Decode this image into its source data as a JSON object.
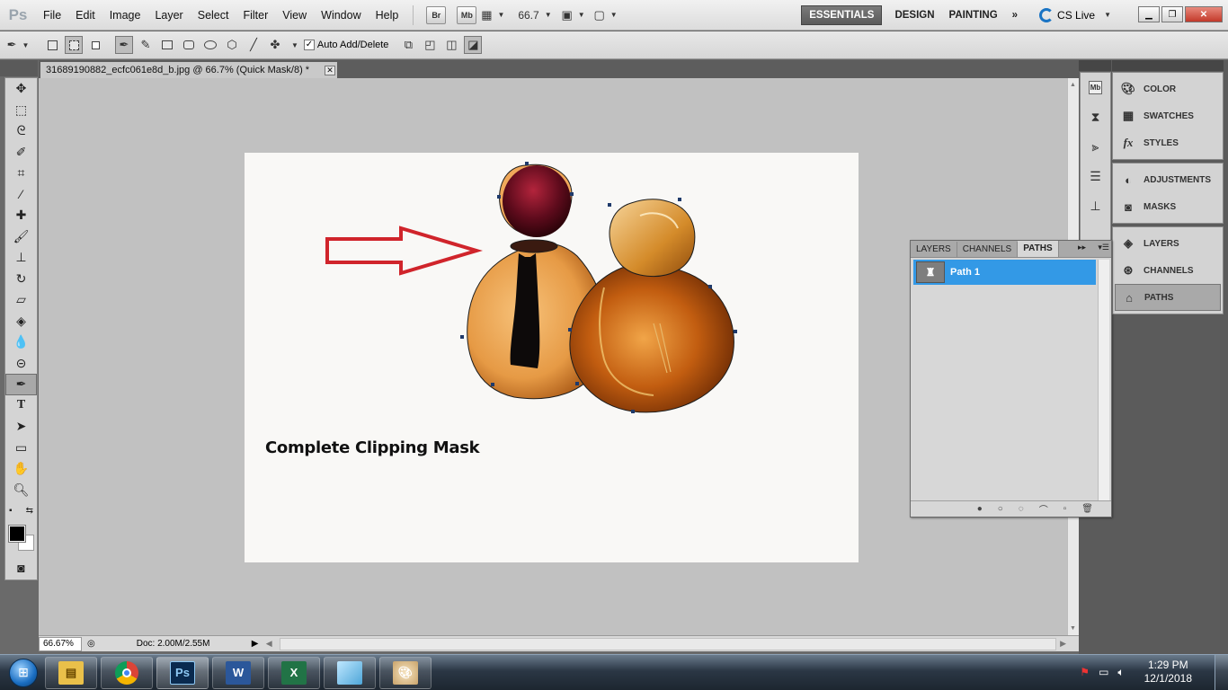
{
  "app": {
    "logo": "Ps",
    "menu": [
      "File",
      "Edit",
      "Image",
      "Layer",
      "Select",
      "Filter",
      "View",
      "Window",
      "Help"
    ],
    "bridge_label": "Br",
    "minibridge_label": "Mb",
    "zoom_value": "66.7",
    "workspaces": [
      "ESSENTIALS",
      "DESIGN",
      "PAINTING"
    ],
    "workspace_more": "»",
    "cslive_label": "CS Live"
  },
  "options_bar": {
    "auto_add_delete_label": "Auto Add/Delete",
    "auto_add_delete_checked": true
  },
  "document": {
    "tab_title": "31689190882_ecfc061e8d_b.jpg @ 66.7% (Quick Mask/8) *",
    "caption": "Complete Clipping Mask",
    "arrow_color": "#d0242b"
  },
  "status": {
    "zoom": "66.67%",
    "doc_info": "Doc: 2.00M/2.55M"
  },
  "dock": {
    "group1": [
      "COLOR",
      "SWATCHES",
      "STYLES"
    ],
    "group2": [
      "ADJUSTMENTS",
      "MASKS"
    ],
    "group3": [
      "LAYERS",
      "CHANNELS",
      "PATHS"
    ],
    "active_item": "PATHS"
  },
  "paths_panel": {
    "tabs": [
      "LAYERS",
      "CHANNELS",
      "PATHS"
    ],
    "active_tab": "PATHS",
    "paths": [
      {
        "name": "Path 1",
        "selected": true
      }
    ]
  },
  "taskbar": {
    "time": "1:29 PM",
    "date": "12/1/2018",
    "apps": [
      "explorer-icon",
      "chrome-icon",
      "photoshop-icon",
      "word-icon",
      "excel-icon",
      "notepad-icon",
      "paint-icon"
    ],
    "ps_label": "Ps",
    "word_label": "W",
    "excel_label": "X"
  }
}
